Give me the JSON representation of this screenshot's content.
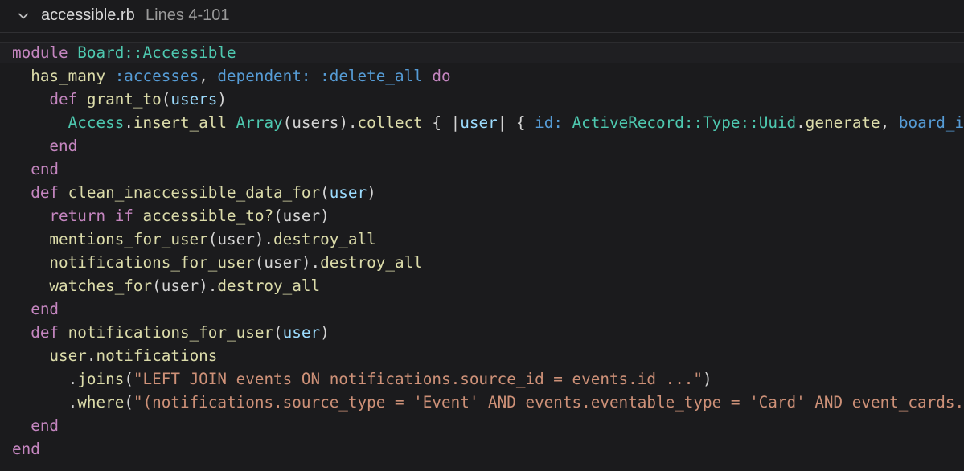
{
  "header": {
    "file_name": "accessible.rb",
    "line_range": "Lines 4-101"
  },
  "colors": {
    "background": "#1b1b1d",
    "keyword": "#c586c0",
    "type": "#4ec9b0",
    "symbol": "#569cd6",
    "function": "#dcdcaa",
    "variable": "#9cdcfe",
    "string": "#ce9178",
    "plain": "#d4d4d4"
  },
  "code_lines": [
    {
      "tokens": [
        {
          "t": "module ",
          "c": "kw"
        },
        {
          "t": "Board::Accessible",
          "c": "type"
        }
      ]
    },
    {
      "tokens": [
        {
          "t": "  has_many ",
          "c": "fn"
        },
        {
          "t": ":accesses",
          "c": "sym"
        },
        {
          "t": ", ",
          "c": "plain"
        },
        {
          "t": "dependent:",
          "c": "sym"
        },
        {
          "t": " ",
          "c": "plain"
        },
        {
          "t": ":delete_all",
          "c": "sym"
        },
        {
          "t": " ",
          "c": "plain"
        },
        {
          "t": "do",
          "c": "kw"
        }
      ]
    },
    {
      "tokens": [
        {
          "t": "    def ",
          "c": "kw"
        },
        {
          "t": "grant_to",
          "c": "fn"
        },
        {
          "t": "(",
          "c": "plain"
        },
        {
          "t": "users",
          "c": "var"
        },
        {
          "t": ")",
          "c": "plain"
        }
      ]
    },
    {
      "tokens": [
        {
          "t": "      Access",
          "c": "type"
        },
        {
          "t": ".",
          "c": "plain"
        },
        {
          "t": "insert_all",
          "c": "fn"
        },
        {
          "t": " ",
          "c": "plain"
        },
        {
          "t": "Array",
          "c": "type"
        },
        {
          "t": "(users).",
          "c": "plain"
        },
        {
          "t": "collect",
          "c": "fn"
        },
        {
          "t": " { |",
          "c": "plain"
        },
        {
          "t": "user",
          "c": "var"
        },
        {
          "t": "| { ",
          "c": "plain"
        },
        {
          "t": "id:",
          "c": "sym"
        },
        {
          "t": " ",
          "c": "plain"
        },
        {
          "t": "ActiveRecord::Type::Uuid",
          "c": "type"
        },
        {
          "t": ".",
          "c": "plain"
        },
        {
          "t": "generate",
          "c": "fn"
        },
        {
          "t": ", ",
          "c": "plain"
        },
        {
          "t": "board_id:",
          "c": "sym"
        }
      ]
    },
    {
      "tokens": [
        {
          "t": "    end",
          "c": "kw"
        }
      ]
    },
    {
      "tokens": [
        {
          "t": "  end",
          "c": "kw"
        }
      ]
    },
    {
      "tokens": [
        {
          "t": "  def ",
          "c": "kw"
        },
        {
          "t": "clean_inaccessible_data_for",
          "c": "fn"
        },
        {
          "t": "(",
          "c": "plain"
        },
        {
          "t": "user",
          "c": "var"
        },
        {
          "t": ")",
          "c": "plain"
        }
      ]
    },
    {
      "tokens": [
        {
          "t": "    return if ",
          "c": "kw"
        },
        {
          "t": "accessible_to?",
          "c": "fn"
        },
        {
          "t": "(user)",
          "c": "plain"
        }
      ]
    },
    {
      "tokens": [
        {
          "t": "    mentions_for_user",
          "c": "fn"
        },
        {
          "t": "(user).",
          "c": "plain"
        },
        {
          "t": "destroy_all",
          "c": "fn"
        }
      ]
    },
    {
      "tokens": [
        {
          "t": "    notifications_for_user",
          "c": "fn"
        },
        {
          "t": "(user).",
          "c": "plain"
        },
        {
          "t": "destroy_all",
          "c": "fn"
        }
      ]
    },
    {
      "tokens": [
        {
          "t": "    watches_for",
          "c": "fn"
        },
        {
          "t": "(user).",
          "c": "plain"
        },
        {
          "t": "destroy_all",
          "c": "fn"
        }
      ]
    },
    {
      "tokens": [
        {
          "t": "  end",
          "c": "kw"
        }
      ]
    },
    {
      "tokens": [
        {
          "t": "  def ",
          "c": "kw"
        },
        {
          "t": "notifications_for_user",
          "c": "fn"
        },
        {
          "t": "(",
          "c": "plain"
        },
        {
          "t": "user",
          "c": "var"
        },
        {
          "t": ")",
          "c": "plain"
        }
      ]
    },
    {
      "tokens": [
        {
          "t": "    user",
          "c": "fn"
        },
        {
          "t": ".",
          "c": "plain"
        },
        {
          "t": "notifications",
          "c": "fn"
        }
      ]
    },
    {
      "tokens": [
        {
          "t": "      .",
          "c": "plain"
        },
        {
          "t": "joins",
          "c": "fn"
        },
        {
          "t": "(",
          "c": "plain"
        },
        {
          "t": "\"LEFT JOIN events ON notifications.source_id = events.id ...\"",
          "c": "str"
        },
        {
          "t": ")",
          "c": "plain"
        }
      ]
    },
    {
      "tokens": [
        {
          "t": "      .",
          "c": "plain"
        },
        {
          "t": "where",
          "c": "fn"
        },
        {
          "t": "(",
          "c": "plain"
        },
        {
          "t": "\"(notifications.source_type = 'Event' AND events.eventable_type = 'Card' AND event_cards.board_id",
          "c": "str"
        }
      ]
    },
    {
      "tokens": [
        {
          "t": "  end",
          "c": "kw"
        }
      ]
    },
    {
      "tokens": [
        {
          "t": "end",
          "c": "kw"
        }
      ]
    }
  ]
}
